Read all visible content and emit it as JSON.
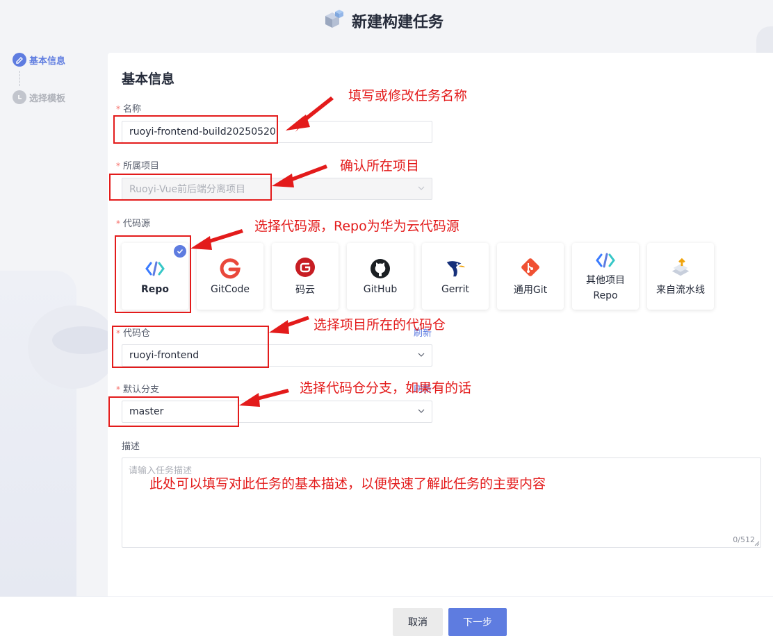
{
  "header": {
    "title": "新建构建任务"
  },
  "steps": [
    {
      "label": "基本信息",
      "state": "active"
    },
    {
      "label": "选择模板",
      "state": "inactive"
    }
  ],
  "card": {
    "title": "基本信息"
  },
  "form": {
    "name": {
      "label": "名称",
      "value": "ruoyi-frontend-build20250520"
    },
    "project": {
      "label": "所属项目",
      "value": "Ruoyi-Vue前后端分离项目"
    },
    "source": {
      "label": "代码源",
      "selected": "Repo",
      "options": [
        {
          "label": "Repo",
          "icon": "codearts-repo-icon"
        },
        {
          "label": "GitCode",
          "icon": "gitcode-icon"
        },
        {
          "label": "码云",
          "icon": "gitee-icon"
        },
        {
          "label": "GitHub",
          "icon": "github-icon"
        },
        {
          "label": "Gerrit",
          "icon": "gerrit-icon"
        },
        {
          "label": "通用Git",
          "icon": "git-icon"
        },
        {
          "label_line1": "其他项目",
          "label_line2": "Repo",
          "icon": "codearts-repo-icon"
        },
        {
          "label": "来自流水线",
          "icon": "pipeline-icon"
        }
      ]
    },
    "repo": {
      "label": "代码仓",
      "value": "ruoyi-frontend",
      "refresh": "刷新"
    },
    "branch": {
      "label": "默认分支",
      "value": "master",
      "refresh": "刷新"
    },
    "description": {
      "label": "描述",
      "placeholder": "请输入任务描述",
      "counter": "0/512"
    }
  },
  "footer": {
    "cancel": "取消",
    "next": "下一步"
  },
  "annotations": {
    "name": "填写或修改任务名称",
    "project": "确认所在项目",
    "source": "选择代码源，Repo为华为云代码源",
    "repo": "选择项目所在的代码仓",
    "branch": "选择代码仓分支，如果有的话",
    "description": "此处可以填写对此任务的基本描述，以便快速了解此任务的主要内容"
  },
  "colors": {
    "accent": "#5e7ce0",
    "annotation": "#e31b1b",
    "required": "#f66f6a"
  }
}
